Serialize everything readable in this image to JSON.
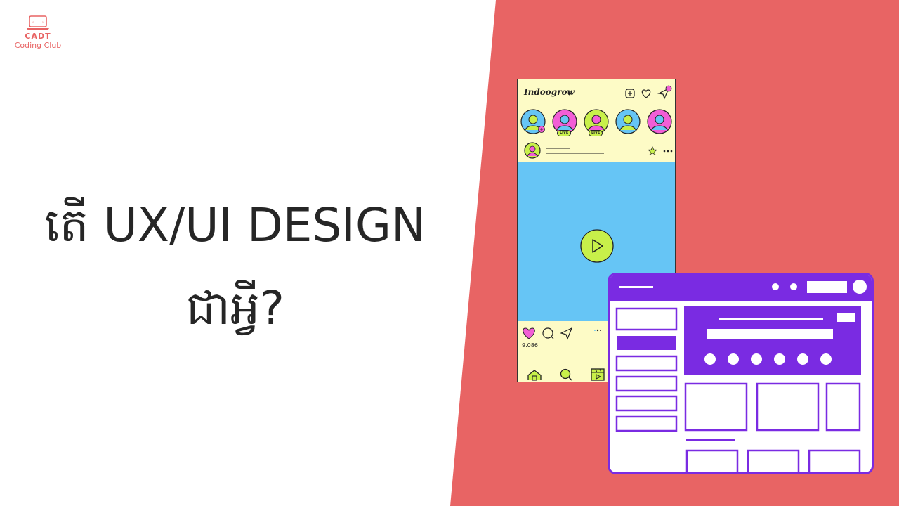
{
  "logo": {
    "line1": "CADT",
    "line2": "Coding Club",
    "icon": "laptop-code-icon"
  },
  "headline": {
    "line1": "តើ UX/UI DESIGN",
    "line2": "ជាអ្វី?"
  },
  "phone": {
    "brand": "Indoogrow",
    "stories": [
      {
        "badge": ""
      },
      {
        "badge": "LIVE"
      },
      {
        "badge": "LIVE"
      },
      {
        "badge": ""
      },
      {
        "badge": ""
      }
    ],
    "likes": "9.086",
    "icons": [
      "add-post-icon",
      "heart-icon",
      "send-icon",
      "play-icon",
      "home-icon",
      "search-icon",
      "reels-icon"
    ]
  },
  "colors": {
    "accent_red": "#e86464",
    "phone_bg": "#fdfbc6",
    "media_blue": "#66c5f5",
    "lime": "#c8f04a",
    "pink": "#f25ed6",
    "purple": "#7a2be2"
  }
}
